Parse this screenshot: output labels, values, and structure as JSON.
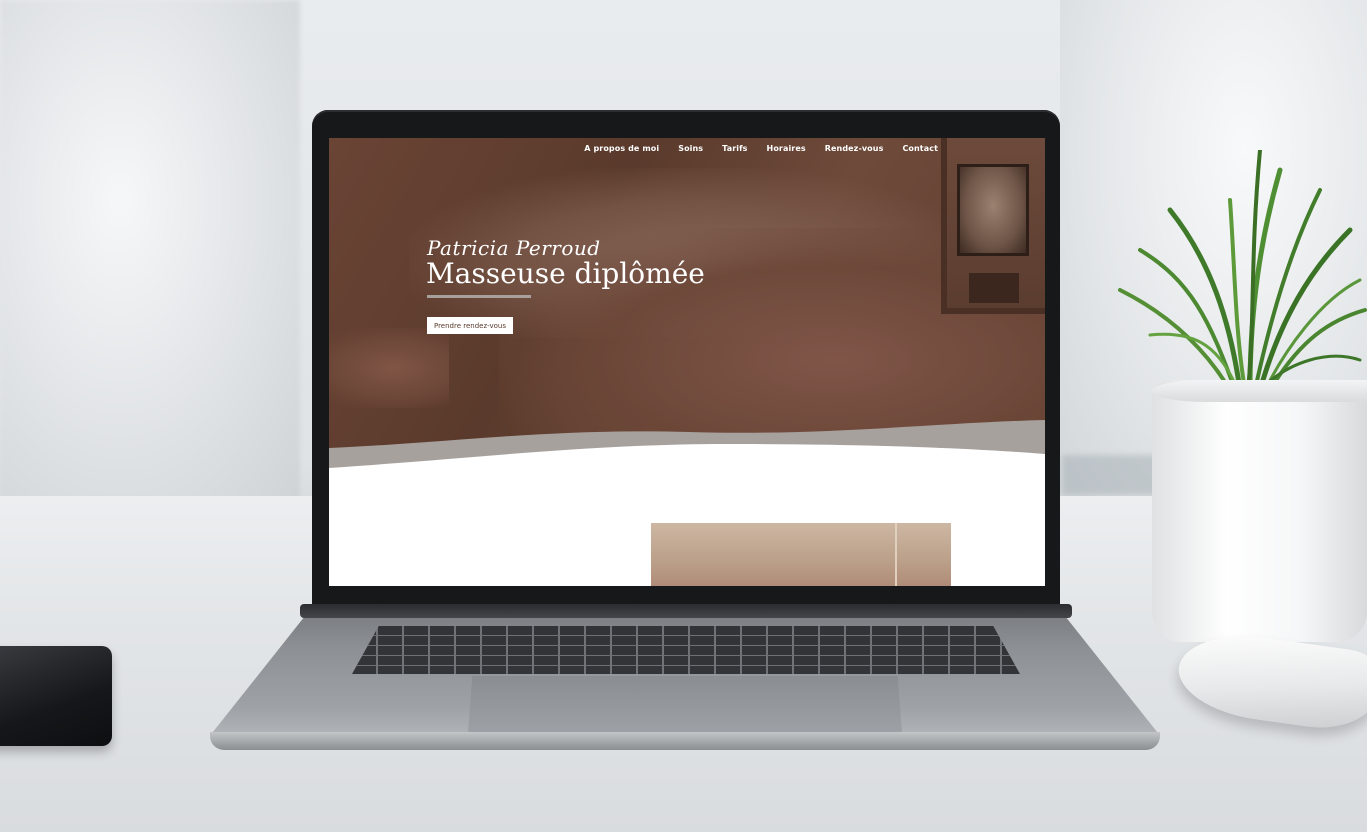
{
  "nav": {
    "items": [
      {
        "label": "A propos de moi"
      },
      {
        "label": "Soins"
      },
      {
        "label": "Tarifs"
      },
      {
        "label": "Horaires"
      },
      {
        "label": "Rendez-vous"
      },
      {
        "label": "Contact"
      }
    ]
  },
  "hero": {
    "subtitle": "Patricia Perroud",
    "title": "Masseuse diplômée",
    "cta_label": "Prendre rendez-vous"
  },
  "colors": {
    "hero_brown": "#6a4435",
    "wave_gray": "#a7a19d",
    "button_text": "#5a3a2c",
    "page_bg": "#ffffff"
  },
  "icons": {
    "plant": "potted-plant-icon",
    "mouse": "computer-mouse-icon",
    "phone": "smartphone-icon"
  }
}
